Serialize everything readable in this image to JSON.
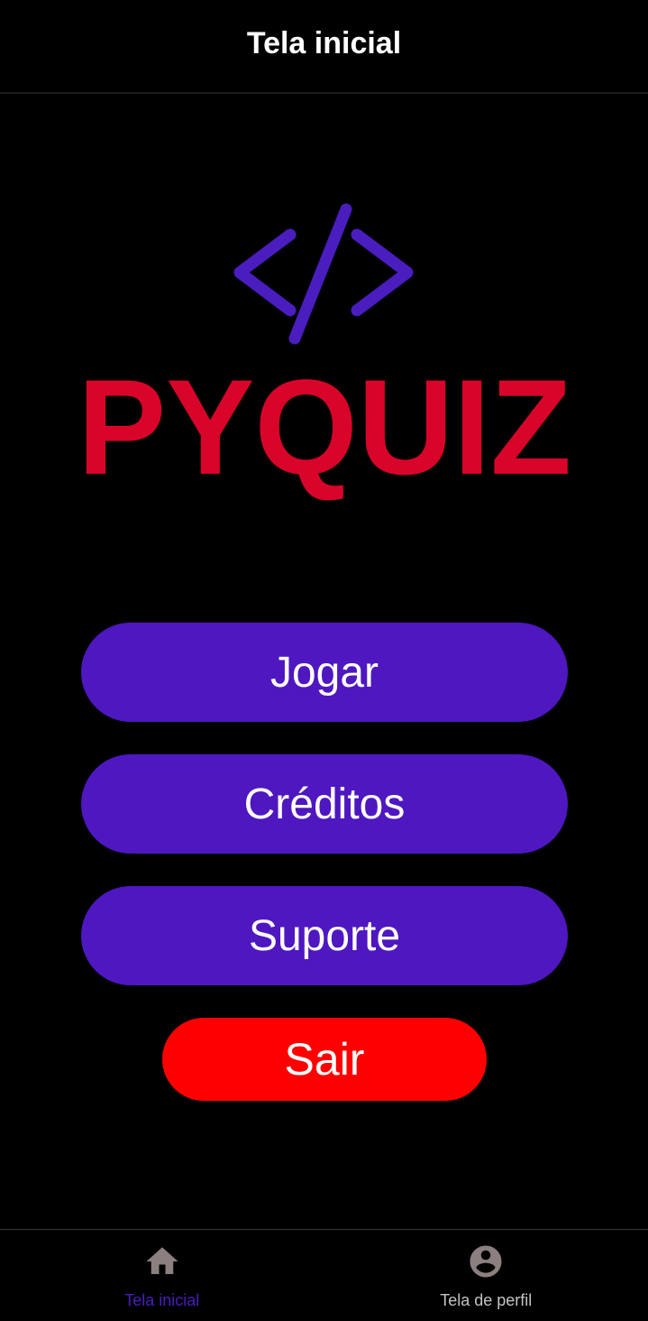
{
  "header": {
    "title": "Tela inicial"
  },
  "logo": {
    "text": "PYQUIZ",
    "symbol": "code-brackets-icon",
    "text_color": "#D90429",
    "symbol_color": "#4A1DBF"
  },
  "menu": {
    "play_label": "Jogar",
    "credits_label": "Créditos",
    "support_label": "Suporte",
    "exit_label": "Sair"
  },
  "colors": {
    "background": "#000000",
    "primary_button": "#4E17C0",
    "exit_button": "#FF0000",
    "nav_active": "#4A1DBF",
    "nav_inactive": "#C4C4C4",
    "nav_icon": "#8C7F7F"
  },
  "bottom_nav": {
    "items": [
      {
        "label": "Tela inicial",
        "icon": "home-icon",
        "active": true
      },
      {
        "label": "Tela de perfil",
        "icon": "account-circle-icon",
        "active": false
      }
    ]
  }
}
